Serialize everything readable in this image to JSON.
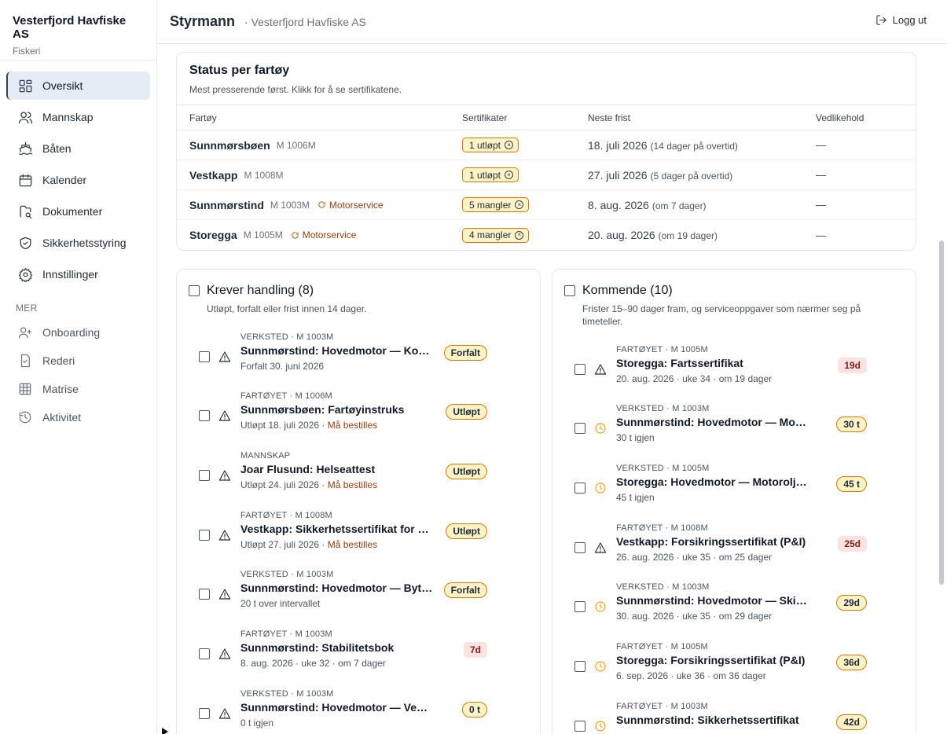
{
  "brand": {
    "name": "Vesterfjord Havfiske AS",
    "sub": "Fiskeri"
  },
  "nav": {
    "items": [
      {
        "label": "Oversikt"
      },
      {
        "label": "Mannskap"
      },
      {
        "label": "Båten"
      },
      {
        "label": "Kalender"
      },
      {
        "label": "Dokumenter"
      },
      {
        "label": "Sikkerhetsstyring"
      },
      {
        "label": "Innstillinger"
      }
    ],
    "mer_label": "MER",
    "sub_items": [
      {
        "label": "Onboarding"
      },
      {
        "label": "Rederi"
      },
      {
        "label": "Matrise"
      },
      {
        "label": "Aktivitet"
      }
    ]
  },
  "header": {
    "title": "Styrmann",
    "sub": "· Vesterfjord Havfiske AS",
    "logout": "Logg ut"
  },
  "status": {
    "title": "Status per fartøy",
    "desc": "Mest presserende først. Klikk for å se sertifikatene.",
    "columns": [
      "Fartøy",
      "Sertifikater",
      "Neste frist",
      "Vedlikehold"
    ],
    "rows": [
      {
        "name": "Sunnmørsbøen",
        "reg": "M 1006M",
        "service": "",
        "cert": "1 utløpt",
        "date": "18. juli 2026",
        "note": "(14 dager på overtid)",
        "maint": "—"
      },
      {
        "name": "Vestkapp",
        "reg": "M 1008M",
        "service": "",
        "cert": "1 utløpt",
        "date": "27. juli 2026",
        "note": "(5 dager på overtid)",
        "maint": "—"
      },
      {
        "name": "Sunnmørstind",
        "reg": "M 1003M",
        "service": "Motorservice",
        "cert": "5 mangler",
        "date": "8. aug. 2026",
        "note": "(om 7 dager)",
        "maint": "—"
      },
      {
        "name": "Storegga",
        "reg": "M 1005M",
        "service": "Motorservice",
        "cert": "4 mangler",
        "date": "20. aug. 2026",
        "note": "(om 19 dager)",
        "maint": "—"
      }
    ]
  },
  "action": {
    "title": "Krever handling (8)",
    "desc": "Utløpt, forfalt eller frist innen 14 dager.",
    "items": [
      {
        "meta": "VERKSTED · M 1003M",
        "name": "Sunnmørstind: Hovedmotor — Kontroll",
        "sub": "Forfalt 30. juni 2026",
        "order": "",
        "badge": "Forfalt"
      },
      {
        "meta": "FARTØYET · M 1006M",
        "name": "Sunnmørsbøen: Fartøyinstruks",
        "sub": "Utløpt 18. juli 2026 · ",
        "order": "Må bestilles",
        "badge": "Utløpt"
      },
      {
        "meta": "MANNSKAP",
        "name": "Joar Flusund: Helseattest",
        "sub": "Utløpt 24. juli 2026 · ",
        "order": "Må bestilles",
        "badge": "Utløpt"
      },
      {
        "meta": "FARTØYET · M 1008M",
        "name": "Vestkapp: Sikkerhetssertifikat for radio",
        "sub": "Utløpt 27. juli 2026 · ",
        "order": "Må bestilles",
        "badge": "Utløpt"
      },
      {
        "meta": "VERKSTED · M 1003M",
        "name": "Sunnmørstind: Hovedmotor — Bytte impeller",
        "sub": "20 t over intervallet",
        "order": "",
        "badge": "Forfalt"
      },
      {
        "meta": "FARTØYET · M 1003M",
        "name": "Sunnmørstind: Stabilitetsbok",
        "sub": "8. aug. 2026 · uke 32 · om 7 dager",
        "order": "",
        "badge": "7d"
      },
      {
        "meta": "VERKSTED · M 1003M",
        "name": "Sunnmørstind: Hovedmotor — Ventiljustering",
        "sub": "0 t igjen",
        "order": "",
        "badge": "0 t"
      }
    ]
  },
  "upcoming": {
    "title": "Kommende (10)",
    "desc": "Frister 15–90 dager fram, og serviceoppgaver som nærmer seg på timeteller.",
    "items": [
      {
        "meta": "FARTØYET · M 1005M",
        "name": "Storegga: Fartssertifikat",
        "sub": "20. aug. 2026 · uke 34 · om 19 dager",
        "badge": "19d",
        "icon": "warn"
      },
      {
        "meta": "VERKSTED · M 1003M",
        "name": "Sunnmørstind: Hovedmotor — Motorolje og filter",
        "sub": "30 t igjen",
        "badge": "30 t",
        "icon": "clock"
      },
      {
        "meta": "VERKSTED · M 1005M",
        "name": "Storegga: Hovedmotor — Motorolje og filter",
        "sub": "45 t igjen",
        "badge": "45 t",
        "icon": "clock"
      },
      {
        "meta": "FARTØYET · M 1008M",
        "name": "Vestkapp: Forsikringssertifikat (P&I)",
        "sub": "26. aug. 2026 · uke 35 · om 25 dager",
        "badge": "25d",
        "icon": "warn"
      },
      {
        "meta": "VERKSTED · M 1003M",
        "name": "Sunnmørstind: Hovedmotor — Skifte drivstoffilter",
        "sub": "30. aug. 2026 · uke 35 · om 29 dager",
        "badge": "29d",
        "icon": "clock"
      },
      {
        "meta": "FARTØYET · M 1005M",
        "name": "Storegga: Forsikringssertifikat (P&I)",
        "sub": "6. sep. 2026 · uke 36 · om 36 dager",
        "badge": "36d",
        "icon": "clock"
      },
      {
        "meta": "FARTØYET · M 1003M",
        "name": "Sunnmørstind: Sikkerhetssertifikat",
        "sub": "",
        "badge": "42d",
        "icon": "clock"
      }
    ]
  },
  "colors": {
    "accent_amber": "#d97706",
    "badge_red_bg": "#fde2e2",
    "nav_active_bg": "#e5ecf5"
  }
}
